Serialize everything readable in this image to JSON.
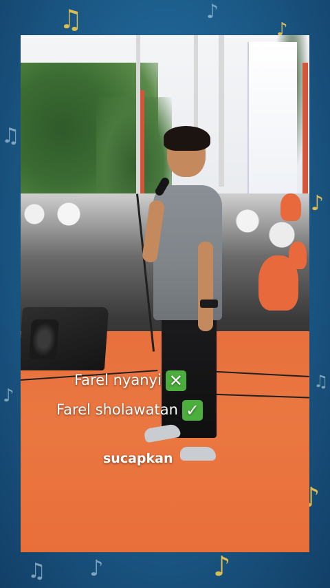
{
  "overlay": {
    "caption_line_1": "Farel nyanyi",
    "caption_line_1_emoji": "✕",
    "caption_line_2": "Farel sholawatan",
    "caption_line_2_emoji": "✓",
    "watermark": "sucapkan"
  },
  "background": {
    "frame_color": "#1d5f8e",
    "note_color": "#cfe8f7",
    "accent_note_color": "#f2c94c"
  },
  "icons": {
    "caption_1_emoji": "cross-mark-icon",
    "caption_2_emoji": "check-mark-icon",
    "decorations": "music-note-icon"
  }
}
